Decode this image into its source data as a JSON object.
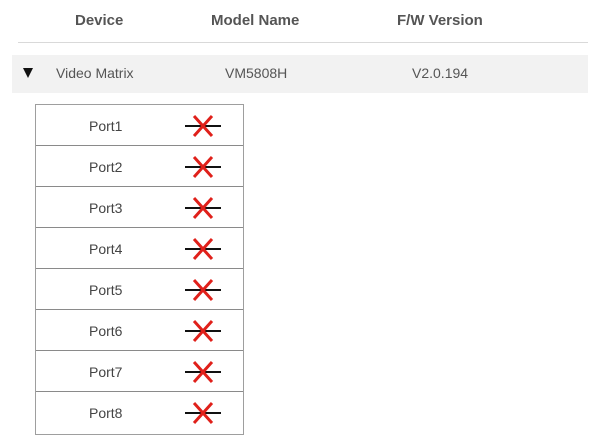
{
  "table": {
    "headers": {
      "device": "Device",
      "model": "Model Name",
      "fw": "F/W Version"
    },
    "device_row": {
      "device": "Video Matrix",
      "model": "VM5808H",
      "fw": "V2.0.194"
    },
    "ports": [
      {
        "label": "Port1",
        "status_icon": "disconnected-icon"
      },
      {
        "label": "Port2",
        "status_icon": "disconnected-icon"
      },
      {
        "label": "Port3",
        "status_icon": "disconnected-icon"
      },
      {
        "label": "Port4",
        "status_icon": "disconnected-icon"
      },
      {
        "label": "Port5",
        "status_icon": "disconnected-icon"
      },
      {
        "label": "Port6",
        "status_icon": "disconnected-icon"
      },
      {
        "label": "Port7",
        "status_icon": "disconnected-icon"
      },
      {
        "label": "Port8",
        "status_icon": "disconnected-icon"
      }
    ]
  },
  "colors": {
    "disconnected": "#e0201a",
    "line": "#111111",
    "row_highlight": "#f2f2f2"
  }
}
